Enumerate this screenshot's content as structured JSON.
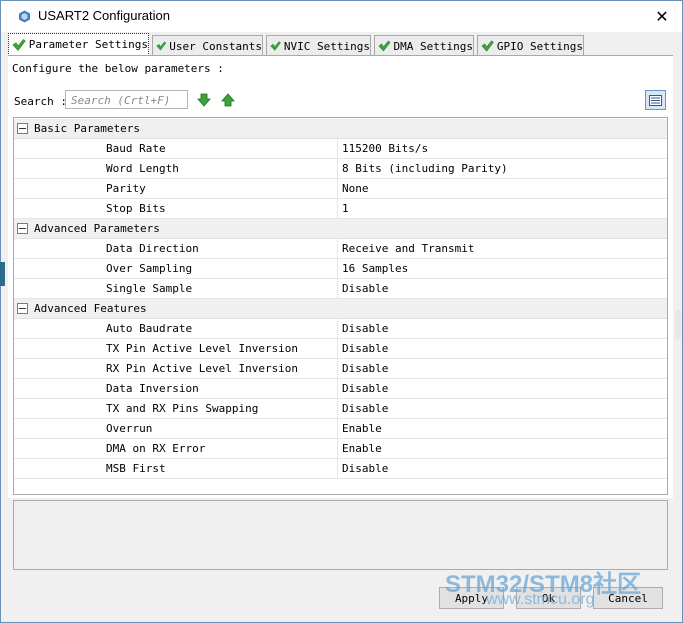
{
  "window": {
    "title": "USART2 Configuration",
    "close_symbol": "✕"
  },
  "tabs": [
    {
      "label": "Parameter Settings",
      "active": true
    },
    {
      "label": "User Constants",
      "active": false
    },
    {
      "label": "NVIC Settings",
      "active": false
    },
    {
      "label": "DMA Settings",
      "active": false
    },
    {
      "label": "GPIO Settings",
      "active": false
    }
  ],
  "description": "Configure the below parameters :",
  "search": {
    "label": "Search :",
    "placeholder": "Search (Crtl+F)"
  },
  "groups": [
    {
      "name": "Basic Parameters",
      "params": [
        {
          "name": "Baud Rate",
          "value": "115200 Bits/s"
        },
        {
          "name": "Word Length",
          "value": "8 Bits (including Parity)"
        },
        {
          "name": "Parity",
          "value": "None"
        },
        {
          "name": "Stop Bits",
          "value": "1"
        }
      ]
    },
    {
      "name": "Advanced Parameters",
      "params": [
        {
          "name": "Data Direction",
          "value": "Receive and Transmit"
        },
        {
          "name": "Over Sampling",
          "value": "16 Samples"
        },
        {
          "name": "Single Sample",
          "value": "Disable"
        }
      ]
    },
    {
      "name": "Advanced Features",
      "params": [
        {
          "name": "Auto Baudrate",
          "value": "Disable"
        },
        {
          "name": "TX Pin Active Level Inversion",
          "value": "Disable"
        },
        {
          "name": "RX Pin Active Level Inversion",
          "value": "Disable"
        },
        {
          "name": "Data Inversion",
          "value": "Disable"
        },
        {
          "name": "TX and RX Pins Swapping",
          "value": "Disable"
        },
        {
          "name": "Overrun",
          "value": "Enable"
        },
        {
          "name": "DMA on RX Error",
          "value": "Enable"
        },
        {
          "name": "MSB First",
          "value": "Disable"
        }
      ]
    }
  ],
  "buttons": {
    "apply": "Apply",
    "ok": "Ok",
    "cancel": "Cancel"
  },
  "watermark": {
    "line1": "STM32/STM8社区",
    "line2": "www.stmcu.org"
  },
  "icons": {
    "tab_status": "green-check-icon",
    "search_down": "green-arrow-down-icon",
    "search_up": "green-arrow-up-icon",
    "view": "list-view-icon"
  },
  "colors": {
    "check_green": "#3aa43a",
    "arrow_green": "#2f9e2f",
    "group_bg": "#f0f0f0",
    "watermark": "#6ba7d6"
  }
}
